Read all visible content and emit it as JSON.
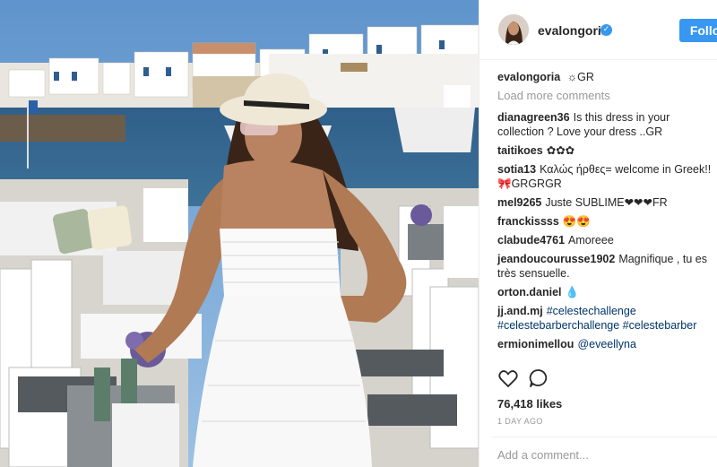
{
  "post": {
    "username": "evalongoria",
    "follow_label": "Follow",
    "caption_user": "evalongoria",
    "caption_text": "☼GR",
    "load_more_label": "Load more comments",
    "likes": "76,418 likes",
    "time_ago": "1 DAY AGO",
    "add_comment_placeholder": "Add a comment..."
  },
  "comments": [
    {
      "user": "dianagreen36",
      "text": "Is this dress in your collection ? Love your dress ..GR"
    },
    {
      "user": "taitikoes",
      "text": "✿✿✿"
    },
    {
      "user": "sotia13",
      "text": "Καλώς ήρθες= welcome in Greek!! 🎀GRGRGR"
    },
    {
      "user": "mel9265",
      "text": "Juste SUBLIME❤❤❤FR"
    },
    {
      "user": "franckissss",
      "text": "😍😍"
    },
    {
      "user": "clabude4761",
      "text": "Amoreee"
    },
    {
      "user": "jeandoucourusse1902",
      "text": "Magnifique , tu es très sensuelle."
    },
    {
      "user": "orton.daniel",
      "text": "💧"
    },
    {
      "user": "jj.and.mj",
      "text": "#celestechallenge #celestebarberchallenge #celestebarber"
    },
    {
      "user": "ermionimellou",
      "text": "@eveellyna"
    }
  ],
  "icons": {
    "verified": "verified-badge-icon",
    "like": "heart-icon",
    "comment": "comment-bubble-icon"
  },
  "colors": {
    "follow_button": "#3897f0",
    "link": "#003569",
    "muted": "#999999"
  }
}
